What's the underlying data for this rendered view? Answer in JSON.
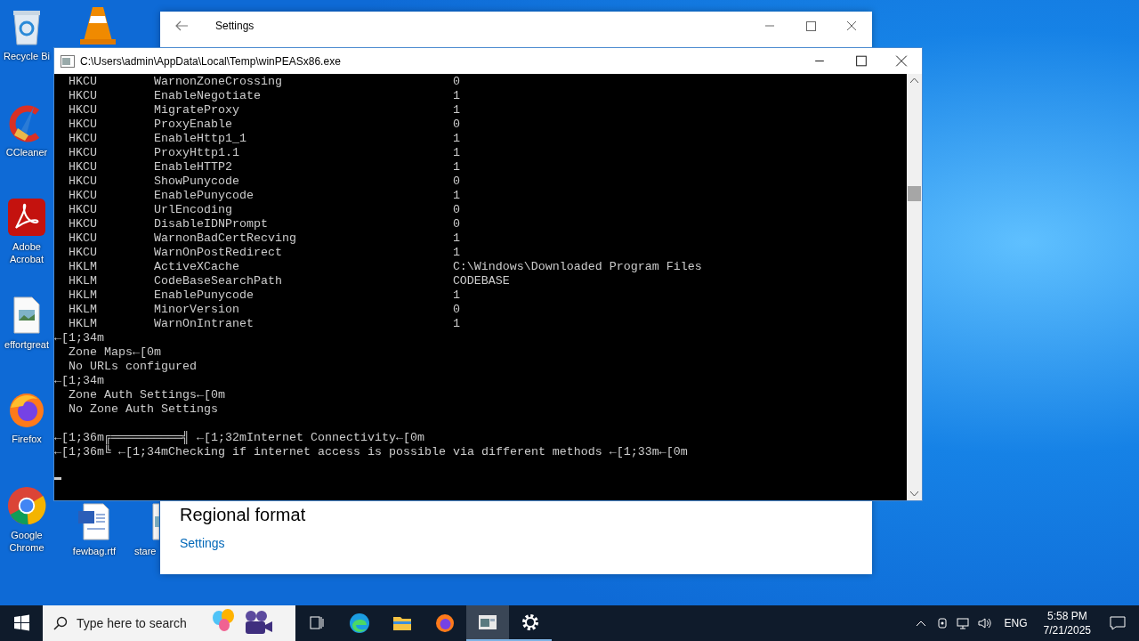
{
  "desktop_icons": [
    {
      "label": "Recycle Bi",
      "kind": "recycle"
    },
    {
      "label": "CCleaner",
      "kind": "ccleaner"
    },
    {
      "label": "Adobe Acrobat",
      "kind": "acrobat"
    },
    {
      "label": "effortgreat",
      "kind": "image-file"
    },
    {
      "label": "Firefox",
      "kind": "firefox"
    },
    {
      "label": "Google Chrome",
      "kind": "chrome"
    },
    {
      "label": "fewbag.rtf",
      "kind": "word"
    },
    {
      "label": "stare",
      "kind": "cut-file"
    }
  ],
  "settings_window": {
    "title": "Settings",
    "heading": "Regional format",
    "link": "Settings"
  },
  "console_window": {
    "title": "C:\\Users\\admin\\AppData\\Local\\Temp\\winPEASx86.exe",
    "lines": [
      {
        "kind": "row",
        "hive": "HKCU",
        "name": "WarnonZoneCrossing",
        "value": "0"
      },
      {
        "kind": "row",
        "hive": "HKCU",
        "name": "EnableNegotiate",
        "value": "1"
      },
      {
        "kind": "row",
        "hive": "HKCU",
        "name": "MigrateProxy",
        "value": "1"
      },
      {
        "kind": "row",
        "hive": "HKCU",
        "name": "ProxyEnable",
        "value": "0"
      },
      {
        "kind": "row",
        "hive": "HKCU",
        "name": "EnableHttp1_1",
        "value": "1"
      },
      {
        "kind": "row",
        "hive": "HKCU",
        "name": "ProxyHttp1.1",
        "value": "1"
      },
      {
        "kind": "row",
        "hive": "HKCU",
        "name": "EnableHTTP2",
        "value": "1"
      },
      {
        "kind": "row",
        "hive": "HKCU",
        "name": "ShowPunycode",
        "value": "0"
      },
      {
        "kind": "row",
        "hive": "HKCU",
        "name": "EnablePunycode",
        "value": "1"
      },
      {
        "kind": "row",
        "hive": "HKCU",
        "name": "UrlEncoding",
        "value": "0"
      },
      {
        "kind": "row",
        "hive": "HKCU",
        "name": "DisableIDNPrompt",
        "value": "0"
      },
      {
        "kind": "row",
        "hive": "HKCU",
        "name": "WarnonBadCertRecving",
        "value": "1"
      },
      {
        "kind": "row",
        "hive": "HKCU",
        "name": "WarnOnPostRedirect",
        "value": "1"
      },
      {
        "kind": "row",
        "hive": "HKLM",
        "name": "ActiveXCache",
        "value": "C:\\Windows\\Downloaded Program Files"
      },
      {
        "kind": "row",
        "hive": "HKLM",
        "name": "CodeBaseSearchPath",
        "value": "CODEBASE"
      },
      {
        "kind": "row",
        "hive": "HKLM",
        "name": "EnablePunycode",
        "value": "1"
      },
      {
        "kind": "row",
        "hive": "HKLM",
        "name": "MinorVersion",
        "value": "0"
      },
      {
        "kind": "row",
        "hive": "HKLM",
        "name": "WarnOnIntranet",
        "value": "1"
      },
      {
        "kind": "escape",
        "text": "←[1;34m"
      },
      {
        "kind": "indented",
        "text": "Zone Maps←[0m"
      },
      {
        "kind": "indented",
        "text": "No URLs configured"
      },
      {
        "kind": "escape",
        "text": "←[1;34m"
      },
      {
        "kind": "indented",
        "text": "Zone Auth Settings←[0m"
      },
      {
        "kind": "indented",
        "text": "No Zone Auth Settings"
      },
      {
        "kind": "blank"
      },
      {
        "kind": "escape",
        "text": "←[1;36m╔══════════╣ ←[1;32mInternet Connectivity←[0m"
      },
      {
        "kind": "escape",
        "text": "←[1;36m╚ ←[1;34mChecking if internet access is possible via different methods ←[1;33m←[0m"
      },
      {
        "kind": "cursor"
      }
    ]
  },
  "taskbar": {
    "search": {
      "placeholder": "Type here to search"
    },
    "apps": [
      {
        "kind": "taskview",
        "running": false,
        "selected": false
      },
      {
        "kind": "edge",
        "running": false,
        "selected": false
      },
      {
        "kind": "explorer",
        "running": false,
        "selected": false
      },
      {
        "kind": "firefox",
        "running": false,
        "selected": false
      },
      {
        "kind": "console",
        "running": true,
        "selected": true
      },
      {
        "kind": "settings",
        "running": true,
        "selected": false
      }
    ],
    "language": "ENG",
    "time": "5:58 PM",
    "date": "7/21/2025"
  }
}
